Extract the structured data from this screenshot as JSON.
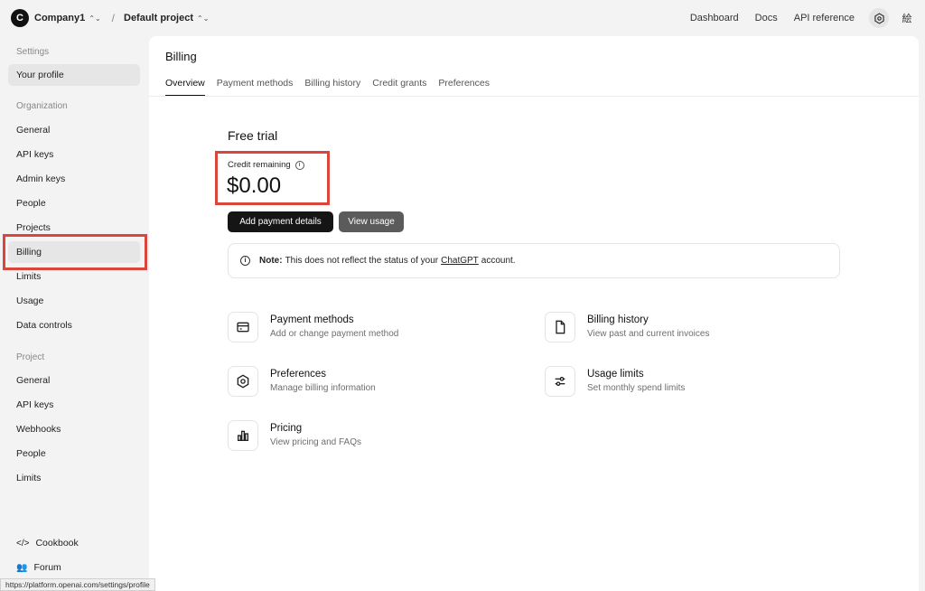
{
  "topbar": {
    "org_initial": "C",
    "org_name": "Company1",
    "project_name": "Default project",
    "links": [
      "Dashboard",
      "Docs",
      "API reference"
    ],
    "lang_glyph": "絵"
  },
  "sidebar": {
    "settings_heading": "Settings",
    "your_profile": "Your profile",
    "organization_heading": "Organization",
    "org_items": [
      "General",
      "API keys",
      "Admin keys",
      "People",
      "Projects",
      "Billing",
      "Limits",
      "Usage",
      "Data controls"
    ],
    "project_heading": "Project",
    "project_items": [
      "General",
      "API keys",
      "Webhooks",
      "People",
      "Limits"
    ],
    "cookbook": "Cookbook",
    "forum": "Forum"
  },
  "main": {
    "title": "Billing",
    "tabs": [
      "Overview",
      "Payment methods",
      "Billing history",
      "Credit grants",
      "Preferences"
    ],
    "plan_title": "Free trial",
    "credit_label": "Credit remaining",
    "credit_value": "$0.00",
    "add_payment_label": "Add payment details",
    "view_usage_label": "View usage",
    "note": {
      "strong": "Note:",
      "text_before": "This does not reflect the status of your",
      "link": "ChatGPT",
      "text_after": "account."
    },
    "cards": [
      {
        "title": "Payment methods",
        "sub": "Add or change payment method",
        "icon": "credit-card-icon"
      },
      {
        "title": "Billing history",
        "sub": "View past and current invoices",
        "icon": "document-icon"
      },
      {
        "title": "Preferences",
        "sub": "Manage billing information",
        "icon": "settings-icon"
      },
      {
        "title": "Usage limits",
        "sub": "Set monthly spend limits",
        "icon": "sliders-icon"
      },
      {
        "title": "Pricing",
        "sub": "View pricing and FAQs",
        "icon": "bar-chart-icon"
      }
    ]
  },
  "status_url": "https://platform.openai.com/settings/profile",
  "colors": {
    "highlight": "#d9463b",
    "primary_button": "#151515",
    "secondary_button": "#5b5b5b"
  }
}
